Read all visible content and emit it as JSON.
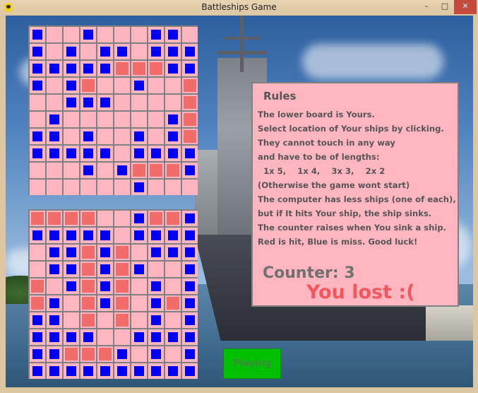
{
  "window": {
    "title": "Battleships Game",
    "minimize_glyph": "–",
    "maximize_glyph": "□",
    "close_glyph": "✕"
  },
  "colors": {
    "cell_empty": "#ffb6c1",
    "miss": "#0000f5",
    "hit": "#f26b6b",
    "grid_line": "#808080",
    "button": "#00c000"
  },
  "boards": {
    "computer": [
      "M..M...MM.",
      "M.M.MM.MMM",
      "MMMMMHHHMM",
      "M.MH..M..H",
      "..MMM....H",
      ".M......MH",
      "MM.M..M.MH",
      "MMMMM.MMMM",
      "...M.MHHHM",
      "......M..."
    ],
    "player": [
      "HHHH..MHHM",
      "MMMMM.MMMM",
      ".MMHMH.MMM",
      ".MMHMHM..M",
      "H.MHMH.M.M",
      "HM.HMH.MHM",
      "MM.H.H.M.M",
      "MMMM..MMMM",
      "MMHHHM.M.M",
      "MMMMMMMMMM"
    ]
  },
  "rules": {
    "title": "Rules",
    "lines": [
      "The lower board is Yours.",
      "Select location of Your ships by clicking.",
      "They cannot touch in any way",
      "and have to be of lengths:",
      "  1x 5,    1x 4,    3x 3,    2x 2",
      "(Otherwise the game wont start)",
      "The computer has less ships (one of each),",
      "but if It hits Your ship, the ship sinks.",
      "The counter raises when You sink a ship.",
      "Red is hit, Blue is miss. Good luck!"
    ],
    "counter_label": "Counter: 3",
    "result": "You lost :("
  },
  "status_button": {
    "label": "Playing"
  }
}
